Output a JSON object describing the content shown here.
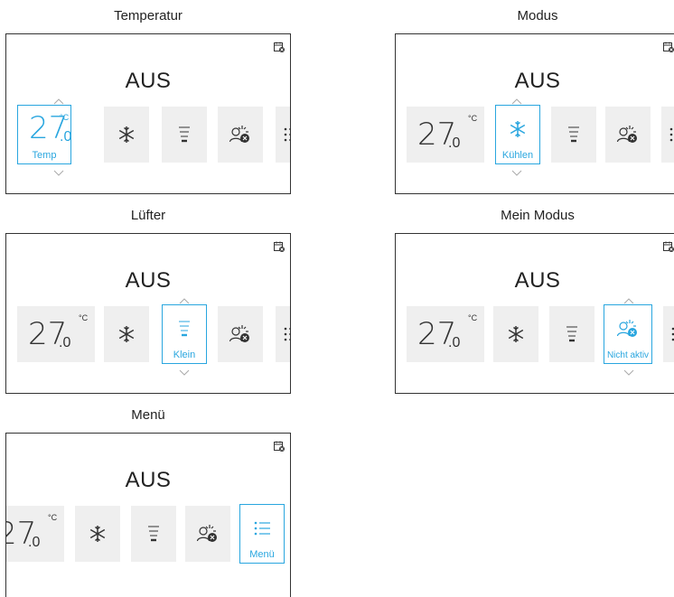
{
  "status": "AUS",
  "temperature": {
    "value": "27",
    "decimal": ".0",
    "unit": "°C"
  },
  "panels": [
    {
      "title": "Temperatur",
      "selected_label": "Temp"
    },
    {
      "title": "Modus",
      "selected_label": "Kühlen"
    },
    {
      "title": "Lüfter",
      "selected_label": "Klein"
    },
    {
      "title": "Mein Modus",
      "selected_label": "Nicht aktiv"
    },
    {
      "title": "Menü",
      "selected_label": "Menü"
    }
  ],
  "icons": {
    "schedule": "schedule-off-icon",
    "mode": "snowflake-icon",
    "fan": "fan-speed-icon",
    "my_mode": "my-mode-off-icon",
    "menu": "menu-list-icon"
  },
  "colors": {
    "accent": "#29a6df",
    "tile_bg": "#efefef",
    "text": "#222222"
  }
}
